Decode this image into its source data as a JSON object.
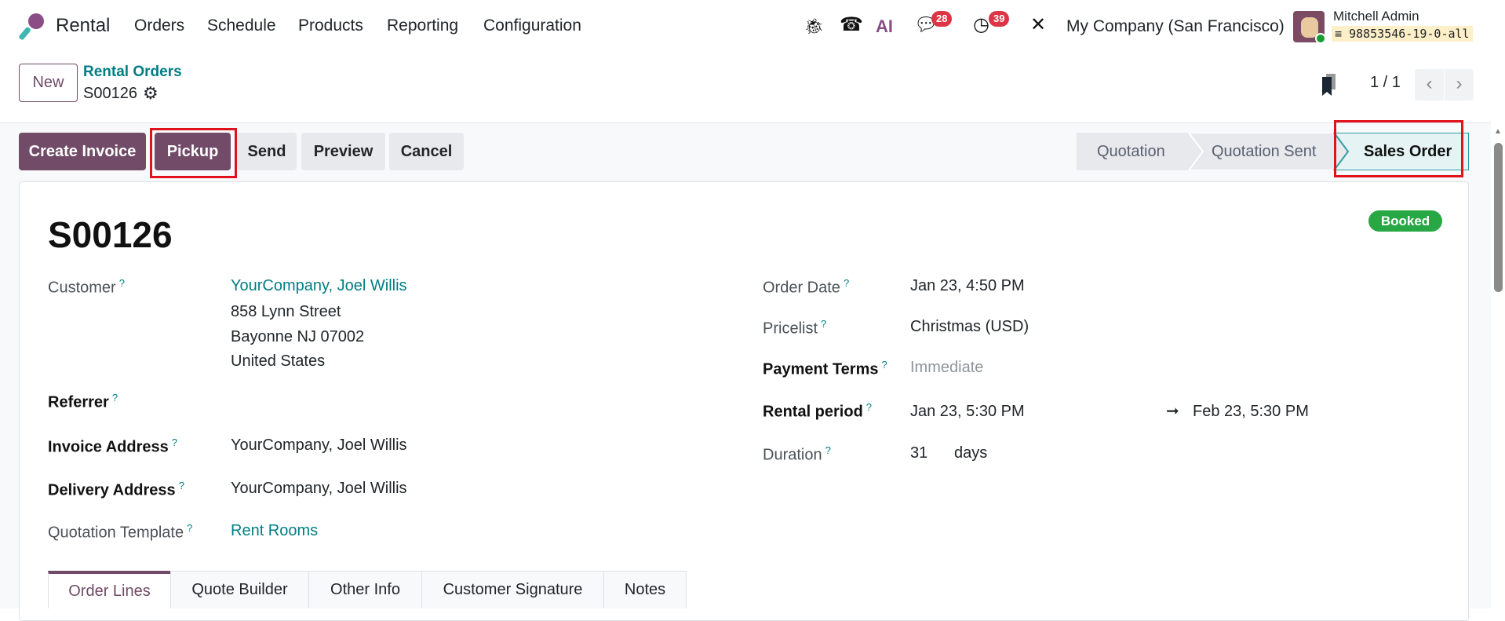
{
  "navbar": {
    "app_name": "Rental",
    "menu": [
      "Orders",
      "Schedule",
      "Products",
      "Reporting",
      "Configuration"
    ],
    "chat_count": "28",
    "activity_count": "39",
    "ai_label": "AI",
    "company": "My Company (San Francisco)",
    "user_name": "Mitchell Admin",
    "database": "98853546-19-0-all"
  },
  "control": {
    "new_label": "New",
    "breadcrumb_parent": "Rental Orders",
    "breadcrumb_current": "S00126",
    "pager": "1 / 1"
  },
  "actions": {
    "create_invoice": "Create Invoice",
    "pickup": "Pickup",
    "send": "Send",
    "preview": "Preview",
    "cancel": "Cancel"
  },
  "statusbar": {
    "steps": [
      "Quotation",
      "Quotation Sent",
      "Sales Order"
    ],
    "active": "Sales Order"
  },
  "form": {
    "title": "S00126",
    "badge": "Booked",
    "help": "?",
    "customer_label": "Customer",
    "customer": "YourCompany, Joel Willis",
    "address": [
      "858 Lynn Street",
      "Bayonne NJ 07002",
      "United States"
    ],
    "referrer_label": "Referrer",
    "invoice_label": "Invoice Address",
    "invoice": "YourCompany, Joel Willis",
    "delivery_label": "Delivery Address",
    "delivery": "YourCompany, Joel Willis",
    "template_label": "Quotation Template",
    "template": "Rent Rooms",
    "order_date_label": "Order Date",
    "order_date": "Jan 23, 4:50 PM",
    "pricelist_label": "Pricelist",
    "pricelist": "Christmas (USD)",
    "payment_label": "Payment Terms",
    "payment": "Immediate",
    "rental_label": "Rental period",
    "rental_start": "Jan 23, 5:30 PM",
    "rental_end": "Feb 23, 5:30 PM",
    "duration_label": "Duration",
    "duration": "31",
    "duration_unit": "days"
  },
  "tabs": [
    "Order Lines",
    "Quote Builder",
    "Other Info",
    "Customer Signature",
    "Notes"
  ],
  "colors": {
    "primary": "#714B67",
    "link": "#017E84",
    "success": "#28a745",
    "danger": "#dc3545"
  }
}
